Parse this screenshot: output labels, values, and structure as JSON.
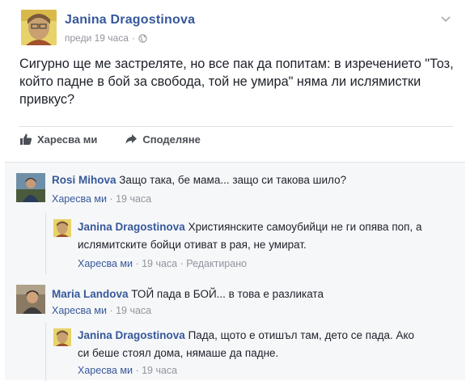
{
  "post": {
    "author": "Janina Dragostinova",
    "time": "преди 19 часа",
    "separator": "·",
    "text": "Сигурно ще ме застреляте, но все пак да попитам: в изречението \"Тоз, който падне в бой за свобода, той не умира\" няма ли ислямистки привкус?",
    "like_label": "Харесва ми",
    "share_label": "Споделяне"
  },
  "comments": [
    {
      "author": "Rosi Mihova",
      "text": "Защо така, бе мама... защо си такова шило?",
      "like_label": "Харесва ми",
      "separator": "·",
      "time": "19 часа",
      "reply": {
        "author": "Janina Dragostinova",
        "text_line1": "Християнските самоубийци не ги опява поп, а",
        "text_line2": "ислямитските бойци отиват в рая, не умират.",
        "like_label": "Харесва ми",
        "separator": "·",
        "time": "19 часа",
        "separator2": "·",
        "edited": "Редактирано"
      }
    },
    {
      "author": "Maria Landova",
      "text": "ТОЙ пада в БОЙ... в това е разликата",
      "like_label": "Харесва ми",
      "separator": "·",
      "time": "19 часа",
      "reply": {
        "author": "Janina Dragostinova",
        "text_line1": "Пада, щото е отишъл там, дето се пада. Ако",
        "text_line2": "си беше стоял дома, нямаше да падне.",
        "like_label": "Харесва ми",
        "separator": "·",
        "time": "19 часа"
      }
    }
  ],
  "icons": {
    "post_menu": "chevron-down-icon",
    "privacy": "globe-icon",
    "like": "thumbs-up-icon",
    "share": "share-arrow-icon"
  },
  "colors": {
    "name_link": "#365899",
    "meta_gray": "#90949c",
    "comments_bg": "#f6f7f9"
  }
}
